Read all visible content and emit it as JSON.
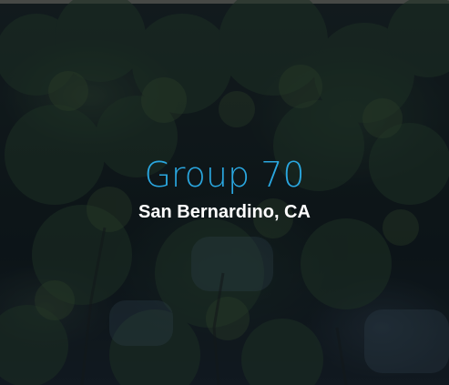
{
  "card": {
    "title": "Group 70",
    "subtitle": "San Bernardino, CA",
    "accent_color": "#2aa7e0",
    "subtitle_color": "#ffffff",
    "background": "dark tree foliage photo"
  }
}
